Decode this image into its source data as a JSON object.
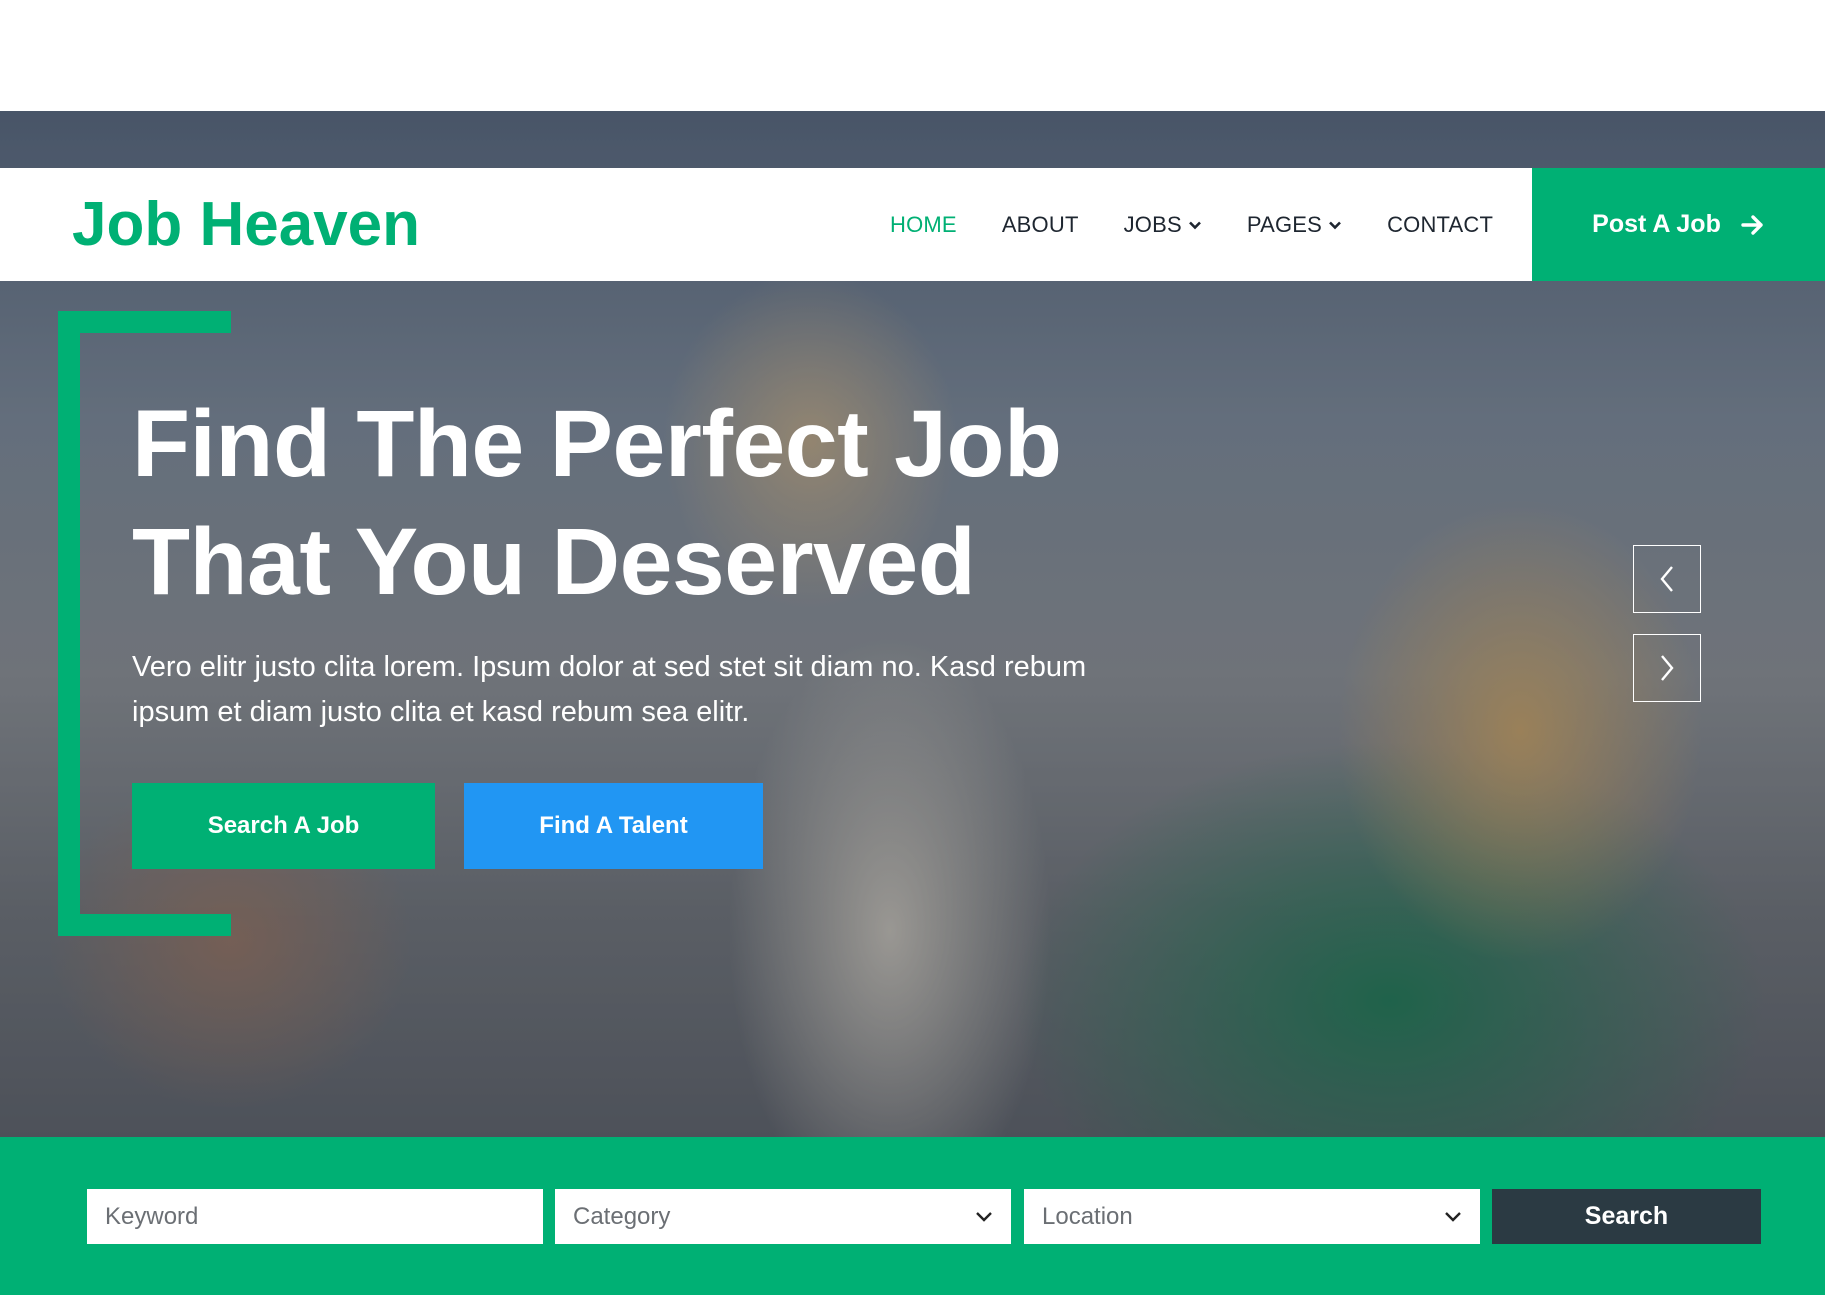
{
  "brand": {
    "name": "Job Heaven"
  },
  "nav": {
    "items": [
      {
        "label": "HOME",
        "active": true,
        "dropdown": false
      },
      {
        "label": "ABOUT",
        "active": false,
        "dropdown": false
      },
      {
        "label": "JOBS",
        "active": false,
        "dropdown": true
      },
      {
        "label": "PAGES",
        "active": false,
        "dropdown": true
      },
      {
        "label": "CONTACT",
        "active": false,
        "dropdown": false
      }
    ],
    "post_job_label": "Post A Job"
  },
  "hero": {
    "title_line1": "Find The Perfect Job",
    "title_line2": "That You Deserved",
    "description": "Vero elitr justo clita lorem. Ipsum dolor at sed stet sit diam no. Kasd rebum ipsum et diam justo clita et kasd rebum sea elitr.",
    "search_job_label": "Search A Job",
    "find_talent_label": "Find A Talent"
  },
  "search": {
    "keyword_placeholder": "Keyword",
    "category_selected": "Category",
    "location_selected": "Location",
    "button_label": "Search"
  },
  "colors": {
    "accent": "#00b074",
    "secondary": "#2196f3",
    "dark": "#2b3a43"
  },
  "icons": {
    "post_job": "arrow-right-icon",
    "carousel_prev": "chevron-left-icon",
    "carousel_next": "chevron-right-icon",
    "select": "chevron-down-icon"
  }
}
